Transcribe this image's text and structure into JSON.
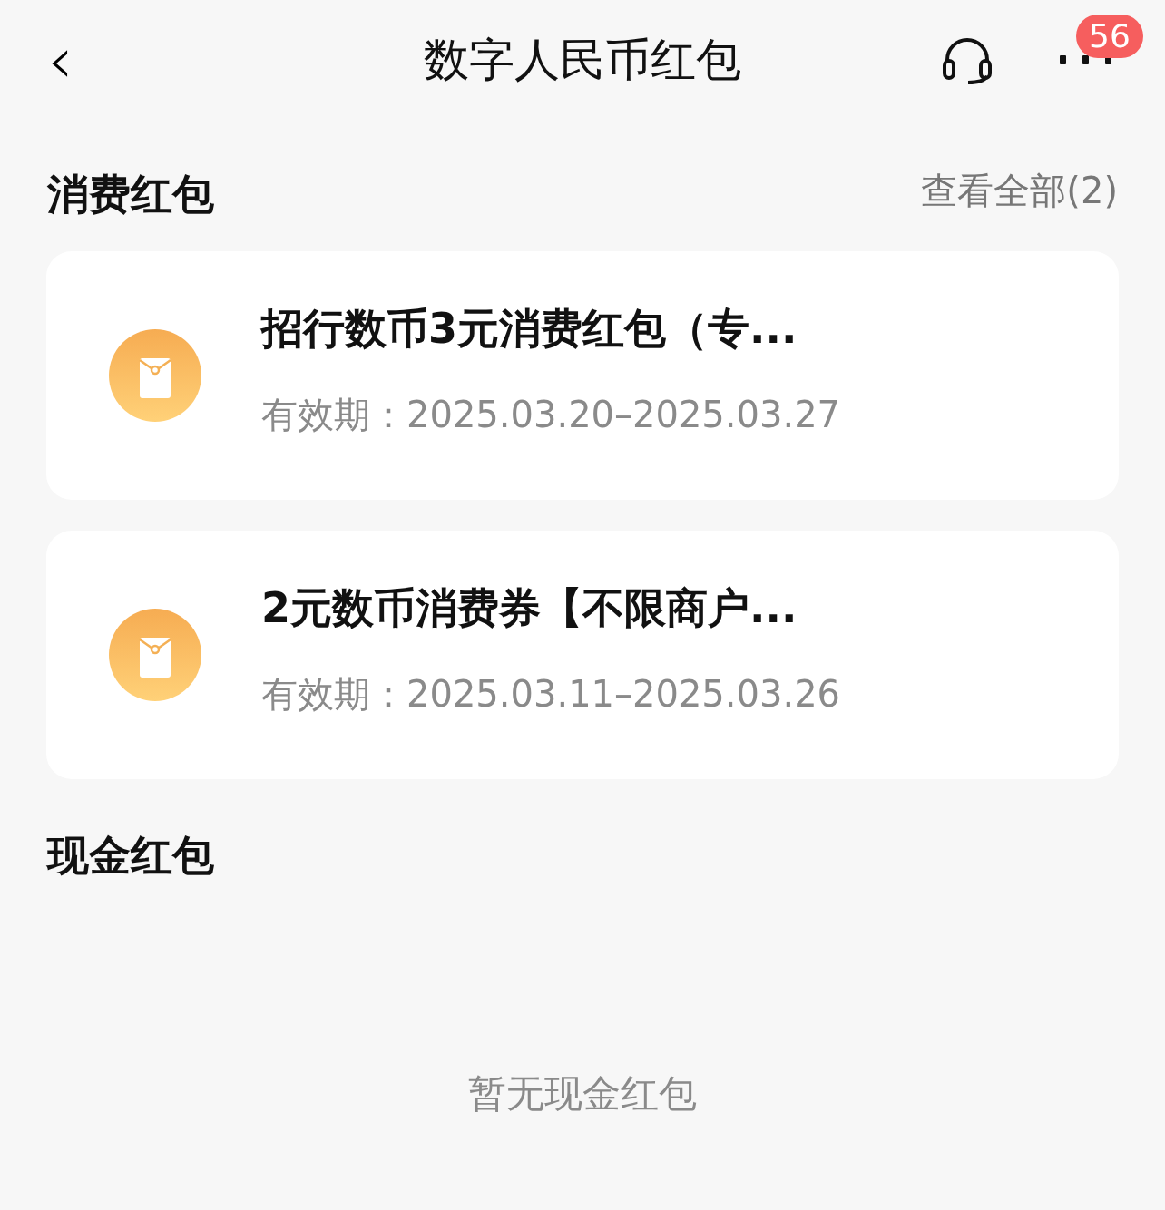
{
  "header": {
    "back": "‹",
    "title": "数字人民币红包",
    "badge": "56"
  },
  "consumption": {
    "title": "消费红包",
    "view_all": "查看全部(2)",
    "items": [
      {
        "name": "招行数币3元消费红包（专...",
        "validity_label": "有效期：",
        "validity": "2025.03.20–2025.03.27"
      },
      {
        "name": "2元数币消费券【不限商户...",
        "validity_label": "有效期：",
        "validity": "2025.03.11–2025.03.26"
      }
    ]
  },
  "cash": {
    "title": "现金红包",
    "empty": "暂无现金红包"
  }
}
